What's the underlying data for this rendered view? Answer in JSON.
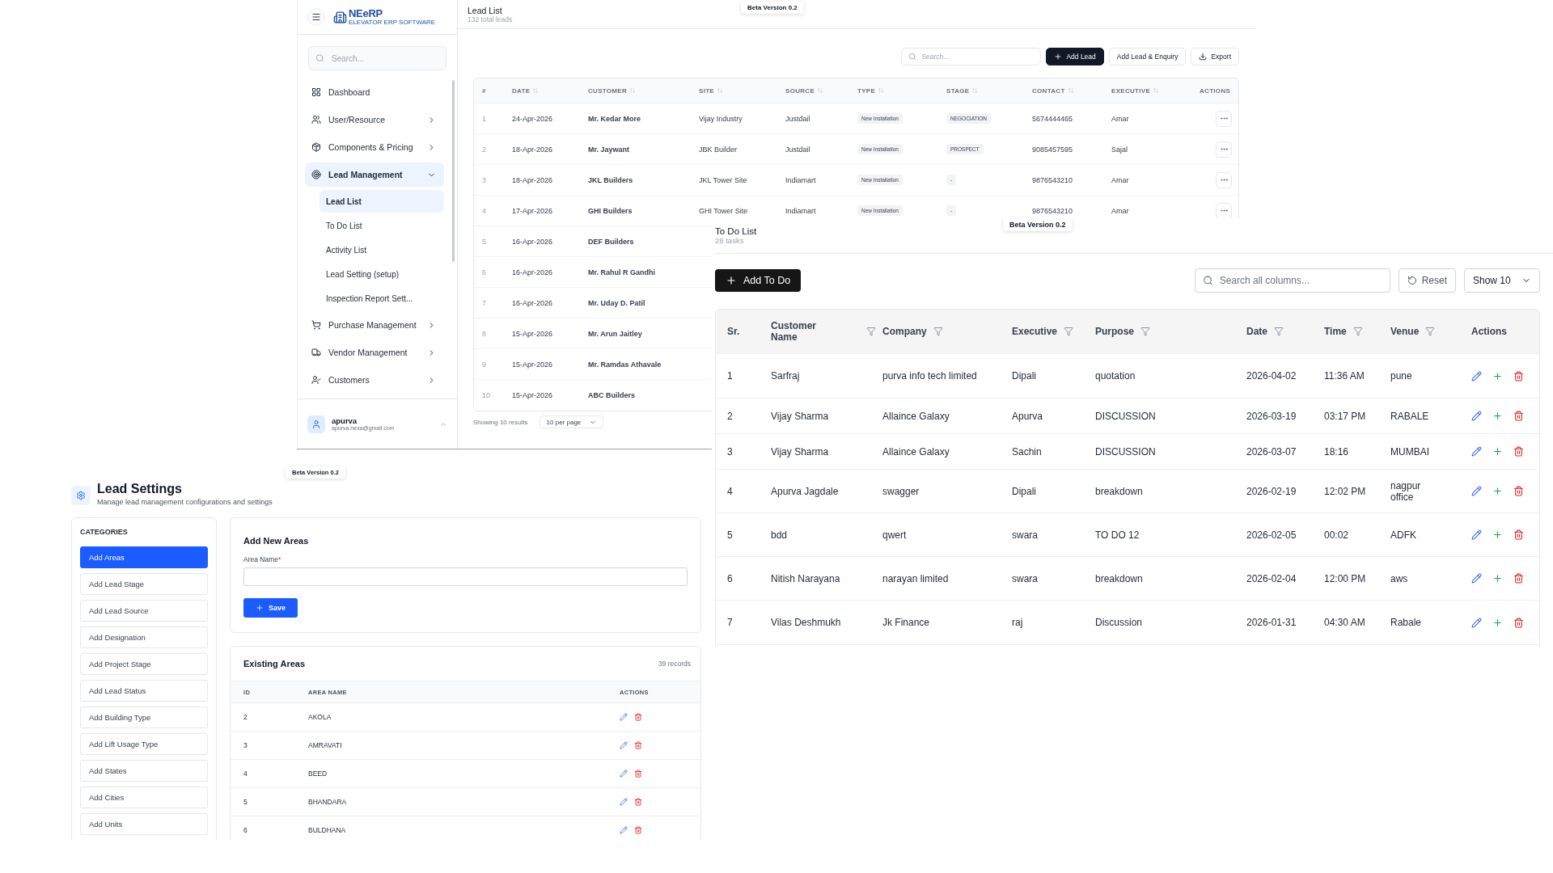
{
  "lead_app": {
    "logo": {
      "text": "NEeRP",
      "tagline": "ELEVATOR ERP SOFTWARE"
    },
    "sidebar": {
      "search": {
        "placeholder": "Search..."
      },
      "items": [
        {
          "label": "Dashboard",
          "selected": false
        },
        {
          "label": "User/Resource",
          "selected": false,
          "expanded": false
        },
        {
          "label": "Components & Pricing",
          "selected": false,
          "expanded": false
        },
        {
          "label": "Lead Management",
          "selected": true,
          "expanded": true,
          "children": [
            {
              "label": "Lead List",
              "selected": true
            },
            {
              "label": "To Do List",
              "selected": false
            },
            {
              "label": "Activity List",
              "selected": false
            },
            {
              "label": "Lead Setting (setup)",
              "selected": false
            },
            {
              "label": "Inspection Report Sett...",
              "selected": false
            }
          ]
        },
        {
          "label": "Purchase Management",
          "selected": false,
          "expanded": false
        },
        {
          "label": "Vendor Management",
          "selected": false,
          "expanded": false
        },
        {
          "label": "Customers",
          "selected": false,
          "expanded": false
        }
      ],
      "user": {
        "name": "apurva",
        "email": "apurva.nexa@gmail.com"
      }
    },
    "page": {
      "title": "Lead List",
      "subtitle": "132 total leads",
      "badge": "Beta Version 0.2"
    },
    "toolbar": {
      "search": {
        "placeholder": "Search..."
      },
      "buttons": [
        {
          "label": "Add Lead",
          "kind": "primary"
        },
        {
          "label": "Add Lead & Enquiry",
          "kind": "outline"
        },
        {
          "label": "Export",
          "kind": "export"
        }
      ]
    },
    "table": {
      "columns": [
        {
          "label": "#",
          "sortable": false
        },
        {
          "label": "DATE",
          "sortable": true
        },
        {
          "label": "CUSTOMER",
          "sortable": true
        },
        {
          "label": "SITE",
          "sortable": true
        },
        {
          "label": "SOURCE",
          "sortable": true
        },
        {
          "label": "TYPE",
          "sortable": true
        },
        {
          "label": "STAGE",
          "sortable": true
        },
        {
          "label": "CONTACT",
          "sortable": true
        },
        {
          "label": "EXECUTIVE",
          "sortable": true
        },
        {
          "label": "ACTIONS",
          "sortable": false
        }
      ],
      "rows": [
        {
          "num": "1",
          "date": "24-Apr-2026",
          "customer": "Mr. Kedar More",
          "site": "Vijay Industry",
          "source": "Justdail",
          "type": "New Installation",
          "stage": "NEGOCIATION",
          "contact": "5674444465",
          "executive": "Amar"
        },
        {
          "num": "2",
          "date": "18-Apr-2026",
          "customer": "Mr. Jaywant",
          "site": "JBK Builder",
          "source": "Justdail",
          "type": "New Installation",
          "stage": "PROSPECT",
          "contact": "9085457595",
          "executive": "Sajal"
        },
        {
          "num": "3",
          "date": "18-Apr-2026",
          "customer": "JKL Builders",
          "site": "JKL Tower Site",
          "source": "Indiamart",
          "type": "New Installation",
          "stage": "-",
          "contact": "9876543210",
          "executive": "Amar"
        },
        {
          "num": "4",
          "date": "17-Apr-2026",
          "customer": "GHI Builders",
          "site": "GHI Tower Site",
          "source": "Indiamart",
          "type": "New Installation",
          "stage": "-",
          "contact": "9876543210",
          "executive": "Amar"
        },
        {
          "num": "5",
          "date": "16-Apr-2026",
          "customer": "DEF Builders"
        },
        {
          "num": "6",
          "date": "16-Apr-2026",
          "customer": "Mr. Rahul R Gandhi"
        },
        {
          "num": "7",
          "date": "16-Apr-2026",
          "customer": "Mr. Uday D. Patil"
        },
        {
          "num": "8",
          "date": "15-Apr-2026",
          "customer": "Mr. Arun Jaitley"
        },
        {
          "num": "9",
          "date": "15-Apr-2026",
          "customer": "Mr. Ramdas Athavale"
        },
        {
          "num": "10",
          "date": "15-Apr-2026",
          "customer": "ABC Builders"
        }
      ]
    },
    "footer": {
      "summary": "Showing 10 results",
      "per_page": "10 per page"
    }
  },
  "todo": {
    "title": "To Do List",
    "subtitle": "28 tasks",
    "badge": "Beta Version 0.2",
    "add_button": "Add To Do",
    "search": {
      "placeholder": "Search all columns..."
    },
    "reset_button": "Reset",
    "page_size": "Show 10",
    "table": {
      "columns": [
        {
          "label": "Sr.",
          "filterable": false
        },
        {
          "label": "Customer Name",
          "filterable": true
        },
        {
          "label": "Company",
          "filterable": true
        },
        {
          "label": "Executive",
          "filterable": true
        },
        {
          "label": "Purpose",
          "filterable": true
        },
        {
          "label": "Date",
          "filterable": true
        },
        {
          "label": "Time",
          "filterable": true
        },
        {
          "label": "Venue",
          "filterable": true
        },
        {
          "label": "Actions",
          "filterable": false
        }
      ],
      "rows": [
        {
          "sr": "1",
          "customer": "Sarfraj",
          "company": "purva info tech limited",
          "executive": "Dipali",
          "purpose": "quotation",
          "date": "2026-04-02",
          "time": "11:36 AM",
          "venue": "pune"
        },
        {
          "sr": "2",
          "customer": "Vijay Sharma",
          "company": "Allaince Galaxy",
          "executive": "Apurva",
          "purpose": "DISCUSSION",
          "date": "2026-03-19",
          "time": "03:17 PM",
          "venue": "RABALE"
        },
        {
          "sr": "3",
          "customer": "Vijay Sharma",
          "company": "Allaince Galaxy",
          "executive": "Sachin",
          "purpose": "DISCUSSION",
          "date": "2026-03-07",
          "time": "18:16",
          "venue": "MUMBAI"
        },
        {
          "sr": "4",
          "customer": "Apurva Jagdale",
          "company": "swagger",
          "executive": "Dipali",
          "purpose": "breakdown",
          "date": "2026-02-19",
          "time": "12:02 PM",
          "venue": "nagpur office"
        },
        {
          "sr": "5",
          "customer": "bdd",
          "company": "qwert",
          "executive": "swara",
          "purpose": "TO DO 12",
          "date": "2026-02-05",
          "time": "00:02",
          "venue": "ADFK"
        },
        {
          "sr": "6",
          "customer": "Nitish Narayana",
          "company": "narayan limited",
          "executive": "swara",
          "purpose": "breakdown",
          "date": "2026-02-04",
          "time": "12:00 PM",
          "venue": "aws"
        },
        {
          "sr": "7",
          "customer": "Vilas Deshmukh",
          "company": "Jk Finance",
          "executive": "raj",
          "purpose": "Discussion",
          "date": "2026-01-31",
          "time": "04:30 AM",
          "venue": "Rabale"
        }
      ]
    }
  },
  "settings": {
    "title": "Lead Settings",
    "subtitle": "Manage lead management configurations and settings",
    "badge": "Beta Version 0.2",
    "categories": {
      "heading": "CATEGORIES",
      "items": [
        {
          "label": "Add Areas",
          "selected": true
        },
        {
          "label": "Add Lead Stage",
          "selected": false
        },
        {
          "label": "Add Lead Source",
          "selected": false
        },
        {
          "label": "Add Designation",
          "selected": false
        },
        {
          "label": "Add Project Stage",
          "selected": false
        },
        {
          "label": "Add Lead Status",
          "selected": false
        },
        {
          "label": "Add Building Type",
          "selected": false
        },
        {
          "label": "Add Lift Usage Type",
          "selected": false
        },
        {
          "label": "Add States",
          "selected": false
        },
        {
          "label": "Add Cities",
          "selected": false
        },
        {
          "label": "Add Units",
          "selected": false
        }
      ]
    },
    "form": {
      "title": "Add New Areas",
      "field_label": "Area Name",
      "required_mark": "*",
      "save_button": "Save"
    },
    "list": {
      "title": "Existing Areas",
      "count": "39 records",
      "columns": [
        "ID",
        "AREA NAME",
        "ACTIONS"
      ],
      "rows": [
        {
          "id": "2",
          "name": "AKOLA"
        },
        {
          "id": "3",
          "name": "AMRAVATI"
        },
        {
          "id": "4",
          "name": "BEED"
        },
        {
          "id": "5",
          "name": "BHANDARA"
        },
        {
          "id": "6",
          "name": "BULDHANA"
        }
      ]
    }
  }
}
